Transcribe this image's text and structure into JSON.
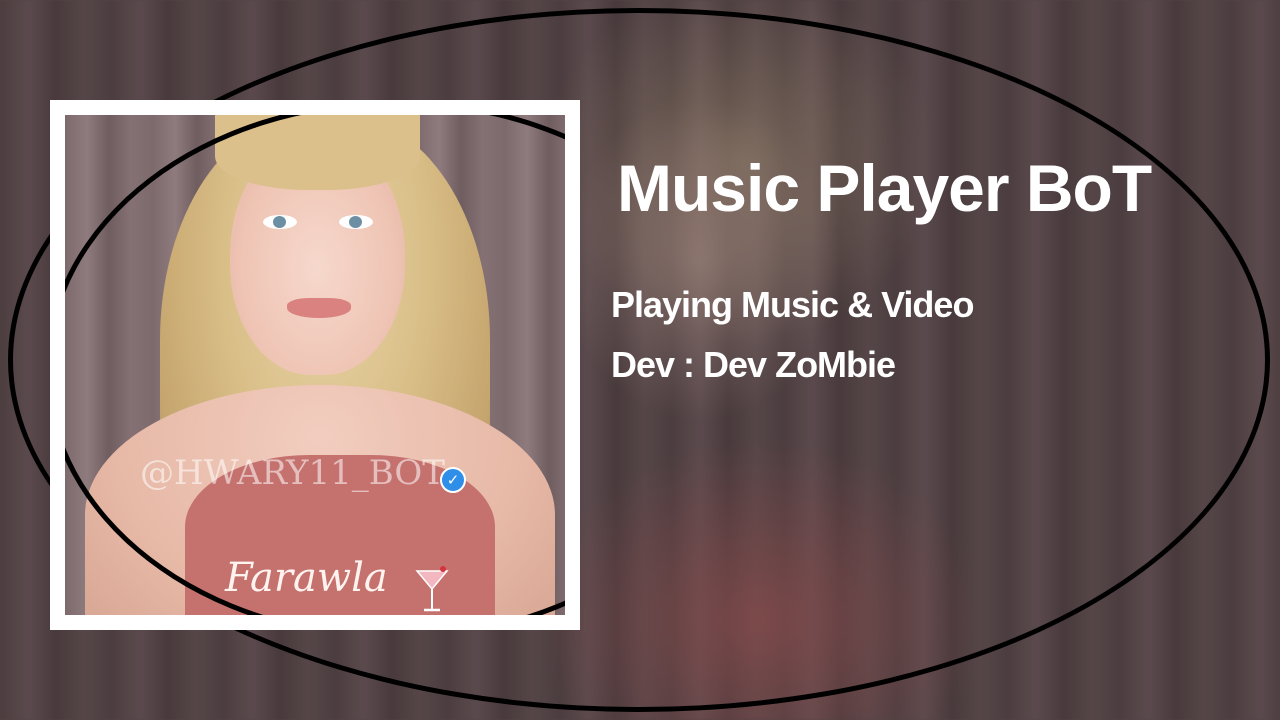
{
  "title": "Music Player BoT",
  "subtitle": "Playing Music & Video",
  "developer_line": "Dev : Dev ZoMbie",
  "cover": {
    "watermark": "@HWARY11_BOT",
    "shirt_text": "Farawla",
    "icons": [
      "verified-icon",
      "cocktail-glass-icon"
    ]
  },
  "colors": {
    "text": "#ffffff",
    "frame": "#ffffff",
    "ring": "#000000",
    "verified": "#2e8ee8"
  }
}
